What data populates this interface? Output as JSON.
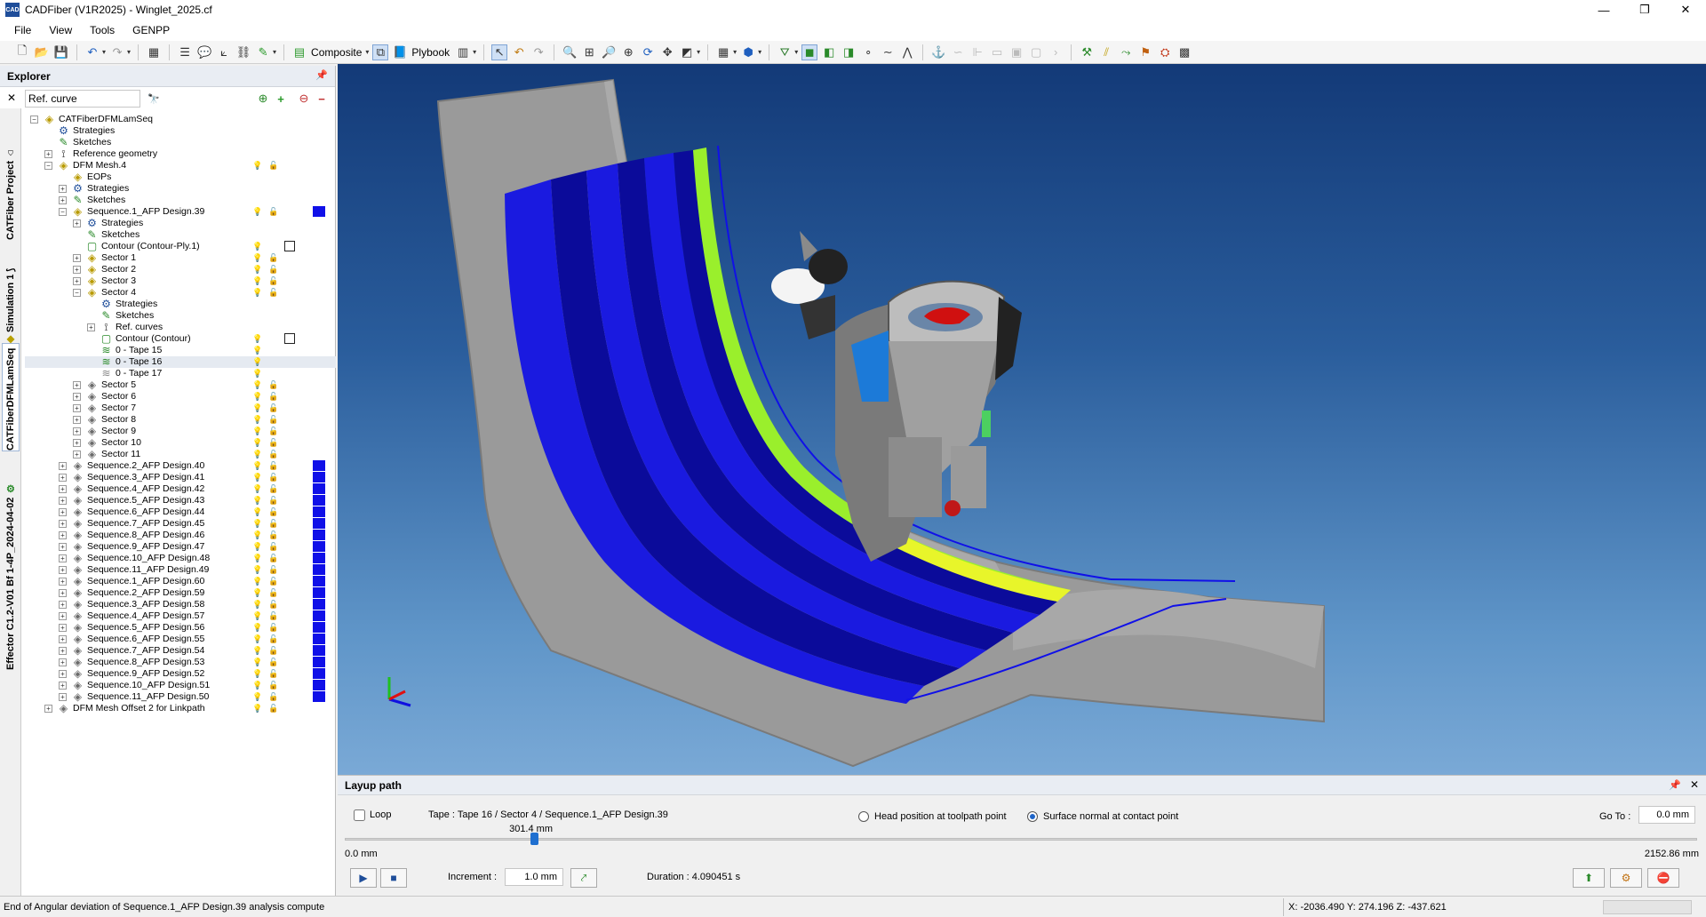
{
  "window": {
    "title": "CADFiber (V1R2025) - Winglet_2025.cf",
    "app_icon_text": "CAD",
    "minimize_glyph": "—",
    "maximize_glyph": "❐",
    "close_glyph": "✕"
  },
  "menu": {
    "items": [
      "File",
      "View",
      "Tools",
      "GENPP"
    ],
    "help": "?"
  },
  "toolbar": {
    "composite_label": "Composite",
    "plybook_label": "Plybook"
  },
  "explorer": {
    "title": "Explorer",
    "pin_glyph": "📌",
    "close_glyph": "✕",
    "search_value": "Ref. curve",
    "side_tabs": [
      "CATFiber Project",
      "Simulation 1",
      "CATFiberDFMLamSeq",
      "Effector C1.2-V01 Bf 1-4P_2024-04-02"
    ],
    "tree": [
      {
        "label": "CATFiberDFMLamSeq",
        "level": 0,
        "toggle": "minus",
        "icon": "seq"
      },
      {
        "label": "Strategies",
        "level": 1,
        "icon": "strat"
      },
      {
        "label": "Sketches",
        "level": 1,
        "icon": "sketch"
      },
      {
        "label": "Reference geometry",
        "level": 1,
        "toggle": "plus",
        "icon": "refgeo"
      },
      {
        "label": "DFM Mesh.4",
        "level": 1,
        "toggle": "minus",
        "icon": "seq",
        "bulb": "yellow",
        "lock": true
      },
      {
        "label": "EOPs",
        "level": 2,
        "icon": "seq"
      },
      {
        "label": "Strategies",
        "level": 2,
        "toggle": "plus",
        "icon": "strat"
      },
      {
        "label": "Sketches",
        "level": 2,
        "toggle": "plus",
        "icon": "sketch"
      },
      {
        "label": "Sequence.1_AFP Design.39",
        "level": 2,
        "toggle": "minus",
        "icon": "seq",
        "bulb": "yellow",
        "lock": true,
        "color": "#1010e8"
      },
      {
        "label": "Strategies",
        "level": 3,
        "toggle": "plus",
        "icon": "strat"
      },
      {
        "label": "Sketches",
        "level": 3,
        "icon": "sketch"
      },
      {
        "label": "Contour (Contour-Ply.1)",
        "level": 3,
        "icon": "contour",
        "bulb": "yellow",
        "checkbox": true
      },
      {
        "label": "Sector 1",
        "level": 3,
        "toggle": "plus",
        "icon": "seq",
        "bulb": "yellow",
        "lock": true
      },
      {
        "label": "Sector 2",
        "level": 3,
        "toggle": "plus",
        "icon": "seq",
        "bulb": "yellow",
        "lock": true
      },
      {
        "label": "Sector 3",
        "level": 3,
        "toggle": "plus",
        "icon": "seq",
        "bulb": "yellow",
        "lock": true
      },
      {
        "label": "Sector 4",
        "level": 3,
        "toggle": "minus",
        "icon": "seq",
        "bulb": "yellow",
        "lock": true
      },
      {
        "label": "Strategies",
        "level": 4,
        "icon": "strat"
      },
      {
        "label": "Sketches",
        "level": 4,
        "icon": "sketch"
      },
      {
        "label": "Ref. curves",
        "level": 4,
        "toggle": "plus",
        "icon": "refgeo"
      },
      {
        "label": "Contour (Contour)",
        "level": 4,
        "icon": "contour",
        "bulb": "yellow",
        "checkbox": true
      },
      {
        "label": "0 - Tape 15",
        "level": 4,
        "icon": "tape",
        "bulb": "yellow"
      },
      {
        "label": "0 - Tape 16",
        "level": 4,
        "icon": "tape",
        "bulb": "yellow",
        "selected": true
      },
      {
        "label": "0 - Tape 17",
        "level": 4,
        "icon": "tape-grey",
        "bulb": "blue"
      },
      {
        "label": "Sector 5",
        "level": 3,
        "toggle": "plus",
        "icon": "seq-grey",
        "bulb": "blue",
        "lock": true
      },
      {
        "label": "Sector 6",
        "level": 3,
        "toggle": "plus",
        "icon": "seq-grey",
        "bulb": "blue",
        "lock": true
      },
      {
        "label": "Sector 7",
        "level": 3,
        "toggle": "plus",
        "icon": "seq-grey",
        "bulb": "blue",
        "lock": true
      },
      {
        "label": "Sector 8",
        "level": 3,
        "toggle": "plus",
        "icon": "seq-grey",
        "bulb": "blue",
        "lock": true
      },
      {
        "label": "Sector 9",
        "level": 3,
        "toggle": "plus",
        "icon": "seq-grey",
        "bulb": "blue",
        "lock": true
      },
      {
        "label": "Sector 10",
        "level": 3,
        "toggle": "plus",
        "icon": "seq-grey",
        "bulb": "blue",
        "lock": true
      },
      {
        "label": "Sector 11",
        "level": 3,
        "toggle": "plus",
        "icon": "seq-grey",
        "bulb": "blue",
        "lock": true
      },
      {
        "label": "Sequence.2_AFP Design.40",
        "level": 2,
        "toggle": "plus",
        "icon": "seq-grey",
        "bulb": "blue",
        "lock": true,
        "color": "#1010e8"
      },
      {
        "label": "Sequence.3_AFP Design.41",
        "level": 2,
        "toggle": "plus",
        "icon": "seq-grey",
        "bulb": "blue",
        "lock": true,
        "color": "#1010e8"
      },
      {
        "label": "Sequence.4_AFP Design.42",
        "level": 2,
        "toggle": "plus",
        "icon": "seq-grey",
        "bulb": "blue",
        "lock": true,
        "color": "#1010e8"
      },
      {
        "label": "Sequence.5_AFP Design.43",
        "level": 2,
        "toggle": "plus",
        "icon": "seq-grey",
        "bulb": "blue",
        "lock": true,
        "color": "#1010e8"
      },
      {
        "label": "Sequence.6_AFP Design.44",
        "level": 2,
        "toggle": "plus",
        "icon": "seq-grey",
        "bulb": "blue",
        "lock": true,
        "color": "#1010e8"
      },
      {
        "label": "Sequence.7_AFP Design.45",
        "level": 2,
        "toggle": "plus",
        "icon": "seq-grey",
        "bulb": "blue",
        "lock": true,
        "color": "#1010e8"
      },
      {
        "label": "Sequence.8_AFP Design.46",
        "level": 2,
        "toggle": "plus",
        "icon": "seq-grey",
        "bulb": "blue",
        "lock": true,
        "color": "#1010e8"
      },
      {
        "label": "Sequence.9_AFP Design.47",
        "level": 2,
        "toggle": "plus",
        "icon": "seq-grey",
        "bulb": "blue",
        "lock": true,
        "color": "#1010e8"
      },
      {
        "label": "Sequence.10_AFP Design.48",
        "level": 2,
        "toggle": "plus",
        "icon": "seq-grey",
        "bulb": "blue",
        "lock": true,
        "color": "#1010e8"
      },
      {
        "label": "Sequence.11_AFP Design.49",
        "level": 2,
        "toggle": "plus",
        "icon": "seq-grey",
        "bulb": "blue",
        "lock": true,
        "color": "#1010e8"
      },
      {
        "label": "Sequence.1_AFP Design.60",
        "level": 2,
        "toggle": "plus",
        "icon": "seq-grey",
        "bulb": "blue",
        "lock": true,
        "color": "#1010e8"
      },
      {
        "label": "Sequence.2_AFP Design.59",
        "level": 2,
        "toggle": "plus",
        "icon": "seq-grey",
        "bulb": "blue",
        "lock": true,
        "color": "#1010e8"
      },
      {
        "label": "Sequence.3_AFP Design.58",
        "level": 2,
        "toggle": "plus",
        "icon": "seq-grey",
        "bulb": "blue",
        "lock": true,
        "color": "#1010e8"
      },
      {
        "label": "Sequence.4_AFP Design.57",
        "level": 2,
        "toggle": "plus",
        "icon": "seq-grey",
        "bulb": "blue",
        "lock": true,
        "color": "#1010e8"
      },
      {
        "label": "Sequence.5_AFP Design.56",
        "level": 2,
        "toggle": "plus",
        "icon": "seq-grey",
        "bulb": "blue",
        "lock": true,
        "color": "#1010e8"
      },
      {
        "label": "Sequence.6_AFP Design.55",
        "level": 2,
        "toggle": "plus",
        "icon": "seq-grey",
        "bulb": "blue",
        "lock": true,
        "color": "#1010e8"
      },
      {
        "label": "Sequence.7_AFP Design.54",
        "level": 2,
        "toggle": "plus",
        "icon": "seq-grey",
        "bulb": "blue",
        "lock": true,
        "color": "#1010e8"
      },
      {
        "label": "Sequence.8_AFP Design.53",
        "level": 2,
        "toggle": "plus",
        "icon": "seq-grey",
        "bulb": "blue",
        "lock": true,
        "color": "#1010e8"
      },
      {
        "label": "Sequence.9_AFP Design.52",
        "level": 2,
        "toggle": "plus",
        "icon": "seq-grey",
        "bulb": "blue",
        "lock": true,
        "color": "#1010e8"
      },
      {
        "label": "Sequence.10_AFP Design.51",
        "level": 2,
        "toggle": "plus",
        "icon": "seq-grey",
        "bulb": "blue",
        "lock": true,
        "color": "#1010e8"
      },
      {
        "label": "Sequence.11_AFP Design.50",
        "level": 2,
        "toggle": "plus",
        "icon": "seq-grey",
        "bulb": "blue",
        "lock": true,
        "color": "#1010e8"
      },
      {
        "label": "DFM Mesh Offset 2 for Linkpath",
        "level": 1,
        "toggle": "plus",
        "icon": "seq-grey",
        "bulb": "blue",
        "lock": true
      }
    ]
  },
  "viewport": {
    "surface_color": "#9a9a9a",
    "ply_color": "#1a1ae0",
    "ply_dark_color": "#0b0b9a",
    "current_tape_color": "#9aef2c",
    "tape_highlight_color": "#e8f52a",
    "background_top": "#133a78",
    "background_bottom": "#7aa9d6"
  },
  "layup": {
    "title": "Layup path",
    "pin_glyph": "📌",
    "close_glyph": "✕",
    "loop_label": "Loop",
    "loop_checked": false,
    "tape_info": "Tape : Tape 16 / Sector 4 / Sequence.1_AFP Design.39",
    "option_head": "Head position at toolpath point",
    "option_surface": "Surface normal at contact point",
    "selected_option": "surface",
    "goto_label": "Go To :",
    "goto_value": "0.0 mm",
    "slider_value_label": "301.4 mm",
    "slider_fraction": 0.14,
    "slider_min": "0.0 mm",
    "slider_max": "2152.86 mm",
    "increment_label": "Increment :",
    "increment_value": "1.0 mm",
    "duration": "Duration : 4.090451 s",
    "play_glyph": "▶",
    "stop_glyph": "■"
  },
  "status": {
    "message": "End of Angular deviation  of Sequence.1_AFP Design.39 analysis compute",
    "coordinates": "X: -2036.490  Y: 274.196  Z: -437.621"
  }
}
